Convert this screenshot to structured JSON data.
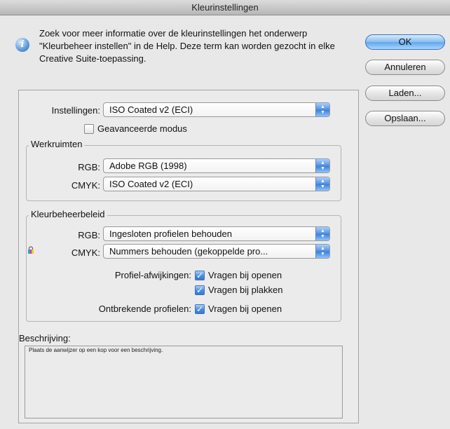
{
  "window": {
    "title": "Kleurinstellingen"
  },
  "info": {
    "icon": "info-icon",
    "text": "Zoek voor meer informatie over de kleurinstellingen het onderwerp \"Kleurbeheer instellen\" in de Help. Deze term kan worden gezocht in elke Creative Suite-toepassing."
  },
  "buttons": {
    "ok": "OK",
    "cancel": "Annuleren",
    "load": "Laden...",
    "save": "Opslaan..."
  },
  "settings": {
    "label": "Instellingen:",
    "value": "ISO Coated v2 (ECI)",
    "advanced_label": "Geavanceerde modus",
    "advanced_checked": false
  },
  "workspaces": {
    "title": "Werkruimten",
    "rgb_label": "RGB:",
    "rgb_value": "Adobe RGB (1998)",
    "cmyk_label": "CMYK:",
    "cmyk_value": "ISO Coated v2 (ECI)"
  },
  "policy": {
    "title": "Kleurbeheerbeleid",
    "rgb_label": "RGB:",
    "rgb_value": "Ingesloten profielen behouden",
    "cmyk_label": "CMYK:",
    "cmyk_value": "Nummers behouden (gekoppelde pro...",
    "lock_icon": "lock-icon",
    "mismatch_label": "Profiel-afwijkingen:",
    "ask_open_label": "Vragen bij openen",
    "ask_open_checked": true,
    "ask_paste_label": "Vragen bij plakken",
    "ask_paste_checked": true,
    "missing_label": "Ontbrekende profielen:",
    "missing_ask_open_label": "Vragen bij openen",
    "missing_ask_open_checked": true
  },
  "description": {
    "label": "Beschrijving:",
    "text": "Plaats de aanwijzer op een kop voor een beschrijving."
  },
  "colors": {
    "accent": "#4a8de0",
    "background": "#e8e8e8"
  }
}
